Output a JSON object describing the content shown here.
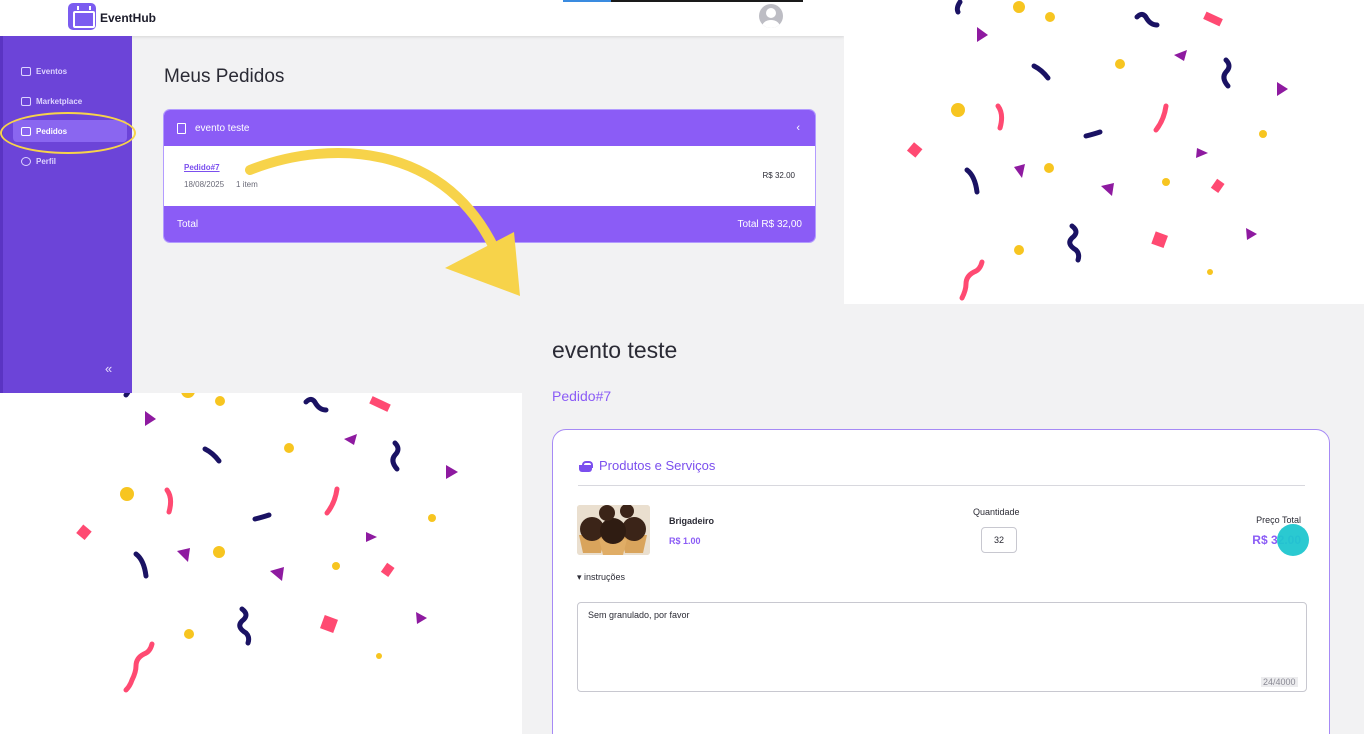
{
  "top_app": {
    "brand": "EventHub",
    "sidebar": {
      "items": [
        {
          "label": "Eventos",
          "icon": "ticket-icon",
          "active": false
        },
        {
          "label": "Marketplace",
          "icon": "bag-icon",
          "active": false
        },
        {
          "label": "Pedidos",
          "icon": "document-icon",
          "active": true
        },
        {
          "label": "Perfil",
          "icon": "user-icon",
          "active": false
        }
      ],
      "collapse_label": "«"
    },
    "page_title": "Meus Pedidos",
    "order_card": {
      "event_name": "evento teste",
      "chevron": "‹",
      "order_link": "Pedido#7",
      "date": "18/08/2025",
      "items_count": "1 item",
      "price": "R$ 32.00",
      "total_label": "Total",
      "total_value": "Total R$ 32,00"
    }
  },
  "detail": {
    "event_title": "evento teste",
    "order_number": "Pedido#7",
    "section_title": "Produtos e Serviços",
    "product": {
      "name": "Brigadeiro",
      "unit_price": "R$ 1.00",
      "quantity_label": "Quantidade",
      "quantity": "32",
      "total_label": "Preço Total",
      "total_value": "R$ 32.00"
    },
    "instructions_toggle": "▾ instruções",
    "instructions_text": "Sem granulado, por favor",
    "char_count": "24/4000"
  },
  "colors": {
    "accent": "#8b5cf6",
    "sidebar": "#6c44d8",
    "highlight": "#f7d34a",
    "cursor": "#1fc6cf",
    "confetti": [
      "#f7c520",
      "#ff4a72",
      "#1a1263",
      "#8e1aa0"
    ]
  }
}
